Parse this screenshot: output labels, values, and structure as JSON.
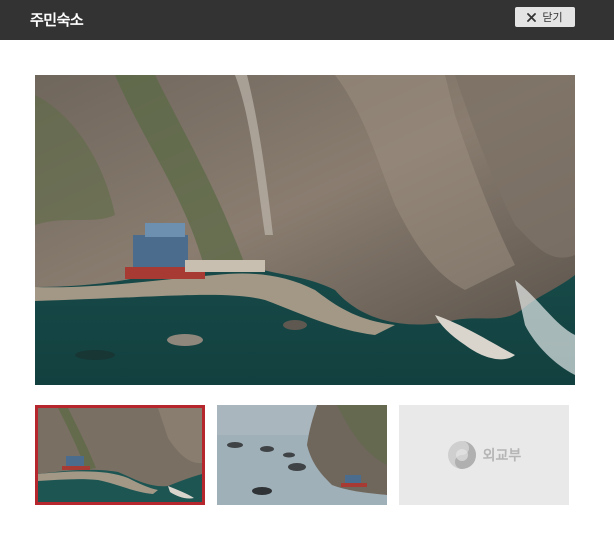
{
  "header": {
    "title": "주민숙소",
    "close_label": "닫기",
    "close_icon": "close-icon"
  },
  "gallery": {
    "selected_index": 0,
    "thumbnails": [
      {
        "kind": "photo"
      },
      {
        "kind": "photo"
      },
      {
        "kind": "placeholder",
        "label": "외교부"
      }
    ]
  },
  "colors": {
    "titlebar": "#333333",
    "selected_border": "#b5272d",
    "placeholder_bg": "#e9e9e9"
  }
}
